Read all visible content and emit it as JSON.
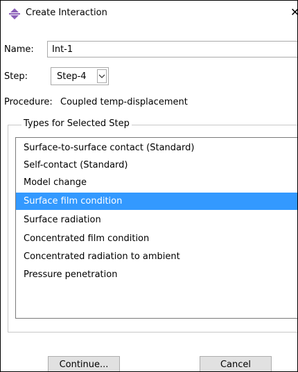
{
  "window": {
    "title": "Create Interaction",
    "icon": "abaqus-interaction-icon",
    "close_glyph": "✕"
  },
  "name": {
    "label": "Name:",
    "value": "Int-1"
  },
  "step": {
    "label": "Step:",
    "value": "Step-4"
  },
  "procedure": {
    "label": "Procedure:",
    "value": "Coupled temp-displacement"
  },
  "types": {
    "title": "Types for Selected Step",
    "items": [
      {
        "label": "Surface-to-surface contact (Standard)",
        "selected": false
      },
      {
        "label": "Self-contact (Standard)",
        "selected": false
      },
      {
        "label": "Model change",
        "selected": false
      },
      {
        "label": "Surface film condition",
        "selected": true
      },
      {
        "label": "Surface radiation",
        "selected": false
      },
      {
        "label": "Concentrated film condition",
        "selected": false
      },
      {
        "label": "Concentrated radiation to ambient",
        "selected": false
      },
      {
        "label": "Pressure penetration",
        "selected": false
      }
    ]
  },
  "buttons": {
    "continue": "Continue...",
    "cancel": "Cancel"
  },
  "colors": {
    "selection": "#3399ff",
    "icon_purple": "#8a5fb8"
  }
}
